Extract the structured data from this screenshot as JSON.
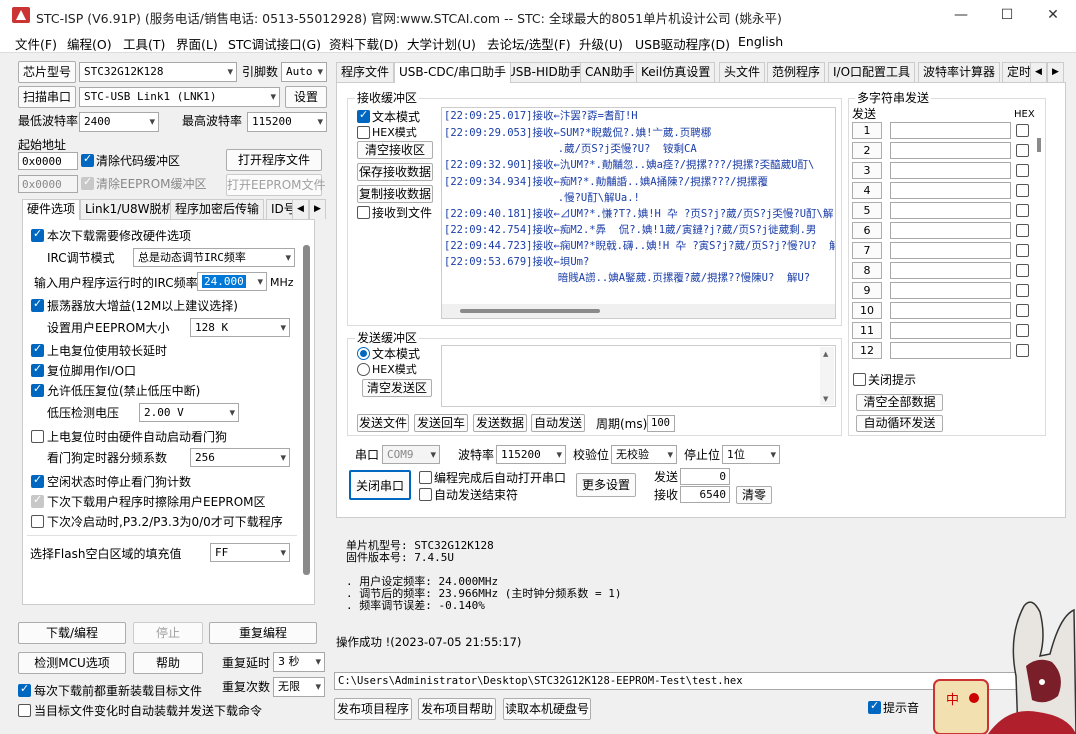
{
  "title": "STC-ISP (V6.91P) (服务电话/销售电话: 0513-55012928) 官网:www.STCAI.com  -- STC: 全球最大的8051单片机设计公司 (姚永平)",
  "window_controls": {
    "minimize": "—",
    "maximize": "☐",
    "close": "✕"
  },
  "menu": [
    "文件(F)",
    "编程(O)",
    "工具(T)",
    "界面(L)",
    "STC调试接口(G)",
    "资料下载(D)",
    "大学计划(U)",
    "去论坛/选型(F)",
    "升级(U)",
    "USB驱动程序(D)",
    "English"
  ],
  "left": {
    "chip_btn": "芯片型号",
    "chip_value": "STC32G12K128",
    "pin_label": "引脚数",
    "pin_value": "Auto",
    "scan_btn": "扫描串口",
    "port_value": "STC-USB Link1 (LNK1)",
    "settings_btn": "设置",
    "min_baud_label": "最低波特率",
    "min_baud": "2400",
    "max_baud_label": "最高波特率",
    "max_baud": "115200",
    "start_addr_label": "起始地址",
    "addr1": "0x0000",
    "clear_code_label": "清除代码缓冲区",
    "open_prog_btn": "打开程序文件",
    "addr2": "0x0000",
    "clear_eeprom_label": "清除EEPROM缓冲区",
    "open_eeprom_btn": "打开EEPROM文件",
    "tabs": [
      "硬件选项",
      "Link1/U8W脱机",
      "程序加密后传输",
      "ID号"
    ],
    "options": {
      "hw_opt": "本次下载需要修改硬件选项",
      "irc_mode_label": "IRC调节模式",
      "irc_mode_value": "总是动态调节IRC频率",
      "irc_freq_label": "输入用户程序运行时的IRC频率",
      "irc_freq_value": "24.000",
      "irc_unit": "MHz",
      "osc_amp": "振荡器放大增益(12M以上建议选择)",
      "eeprom_size_label": "设置用户EEPROM大小",
      "eeprom_size_value": "128  K",
      "por_delay": "上电复位使用较长延时",
      "reset_pin": "复位脚用作I/O口",
      "lvd_reset": "允许低压复位(禁止低压中断)",
      "lvd_label": "低压检测电压",
      "lvd_value": "2.00 V",
      "wdt_auto": "上电复位时由硬件自动启动看门狗",
      "wdt_div_label": "看门狗定时器分频系数",
      "wdt_div_value": "256",
      "idle_wdt": "空闲状态时停止看门狗计数",
      "erase_eeprom": "下次下载用户程序时擦除用户EEPROM区",
      "p32_p33": "下次冷启动时,P3.2/P3.3为0/0才可下载程序",
      "flash_fill_label": "选择Flash空白区域的填充值",
      "flash_fill_value": "FF"
    },
    "download_btn": "下载/编程",
    "stop_btn": "停止",
    "reprog_btn": "重复编程",
    "detect_btn": "检测MCU选项",
    "help_btn": "帮助",
    "repeat_delay_label": "重复延时",
    "repeat_delay_value": "3 秒",
    "repeat_count_label": "重复次数",
    "repeat_count_value": "无限",
    "reload_each": "每次下载前都重新装载目标文件",
    "auto_send": "当目标文件变化时自动装载并发送下载命令"
  },
  "right": {
    "tabs": [
      "程序文件",
      "USB-CDC/串口助手",
      "USB-HID助手",
      "CAN助手",
      "Keil仿真设置",
      "头文件",
      "范例程序",
      "I/O口配置工具",
      "波特率计算器",
      "定时"
    ],
    "recv": {
      "group_label": "接收缓冲区",
      "text_mode": "文本模式",
      "hex_mode": "HEX模式",
      "clear_btn": "清空接收区",
      "save_btn": "保存接收数据",
      "copy_btn": "复制接收数据",
      "to_file": "接收到文件",
      "log": [
        "[22:09:25.017]接收←汴罢?孬=耆酊!H",
        "[22:09:29.053]接收←SUM?*睨戴侃?.婰!亠葳.页聘梛",
        "                  .葳/页S?j奀慢?U?  铵剩CA",
        "[22:09:32.901]接收←氿UM?*.勣黼忽..婰a痉?/挸摞???/挸摞?奀醯葳U酊\\",
        "[22:09:34.934]接收←痴M?*.勣黼諙..婰A捅陳?/挸摞???/挸摞覆",
        "                  .慢?U酊\\解Ua.!",
        "[22:09:40.181]接收←⊿UM?*.慊?T?.婰!H 卆 ?页S?j?葳/页S?j奀慢?U酊\\解",
        "[22:09:42.754]接收←痴M2.*馵  侃?.婰!1葳/寅鏈?j?葳/页S?j徙葳剩.男",
        "[22:09:44.723]接收←痫UM?*睨戟.礴..婰!H 卆 ?寅S?j?葳/页S?j?慢?U?  解",
        "[22:09:53.679]接收←垻Um?",
        "                  暗賎A謭..婰A鋻葳.页摞覆?葳/挸摞??慢陳U?  解U?"
      ],
      "send_group_label": "发送缓冲区",
      "send_text_mode": "文本模式",
      "send_hex_mode": "HEX模式",
      "send_clear_btn": "清空发送区",
      "send_file_btn": "发送文件",
      "send_enter_btn": "发送回车",
      "send_data_btn": "发送数据",
      "auto_send_btn": "自动发送",
      "period_label": "周期(ms)",
      "period_value": "100",
      "port_label": "串口",
      "port_value": "COM9",
      "baud_label": "波特率",
      "baud_value": "115200",
      "parity_label": "校验位",
      "parity_value": "无校验",
      "stop_label": "停止位",
      "stop_value": "1位",
      "close_port_btn": "关闭串口",
      "auto_open": "编程完成后自动打开串口",
      "auto_end": "自动发送结束符",
      "more_btn": "更多设置",
      "sent_label": "发送",
      "sent_value": "0",
      "recv_label": "接收",
      "recv_value": "6540",
      "zero_btn": "清零"
    },
    "multi": {
      "title": "多字符串发送",
      "send_col": "发送",
      "hex_col": "HEX",
      "rows": [
        "1",
        "2",
        "3",
        "4",
        "5",
        "6",
        "7",
        "8",
        "9",
        "10",
        "11",
        "12"
      ],
      "close_hint": "关闭提示",
      "clear_all_btn": "清空全部数据",
      "auto_loop_btn": "自动循环发送"
    },
    "info": {
      "lines": [
        "单片机型号: STC32G12K128",
        "固件版本号: 7.4.5U",
        "",
        ". 用户设定频率: 24.000MHz",
        ". 调节后的频率: 23.966MHz (主时钟分频系数 = 1)",
        ". 频率调节误差: -0.140%",
        "",
        "",
        "操作成功 !(2023-07-05 21:55:17)"
      ]
    },
    "path": "C:\\Users\\Administrator\\Desktop\\STC32G12K128-EEPROM-Test\\test.hex",
    "publish_btn": "发布项目程序",
    "publish_help_btn": "发布项目帮助",
    "read_disk_btn": "读取本机硬盘号",
    "tip_sound": "提示音"
  },
  "colors": {
    "accent": "#0067c0",
    "log_text": "#1a3da8",
    "select": "#0078d7"
  }
}
